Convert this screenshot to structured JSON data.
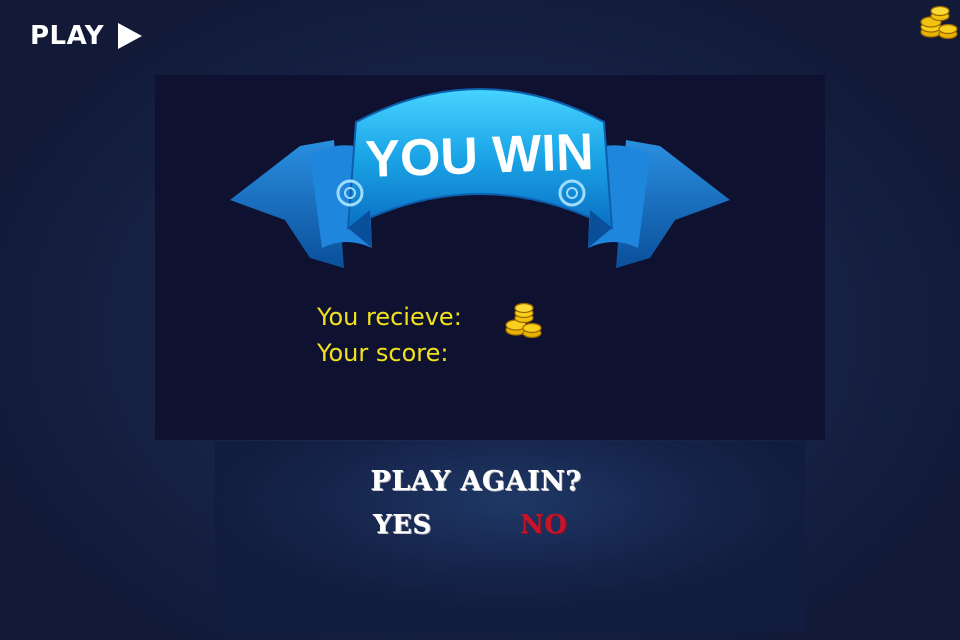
{
  "header": {
    "play_label": "PLAY",
    "play_icon": "play-triangle-icon",
    "coins_icon": "coin-stack-icon"
  },
  "banner": {
    "title": "YOU WIN",
    "ribbon_color": "#2aa8ea"
  },
  "rewards": {
    "receive_label": "You recieve:",
    "receive_icon": "coin-stack-icon",
    "score_label": "Your score:",
    "text_color": "#f2e21d"
  },
  "dialog": {
    "prompt": "PLAY AGAIN?",
    "yes_label": "YES",
    "no_label": "NO",
    "no_color": "#c8142a"
  }
}
